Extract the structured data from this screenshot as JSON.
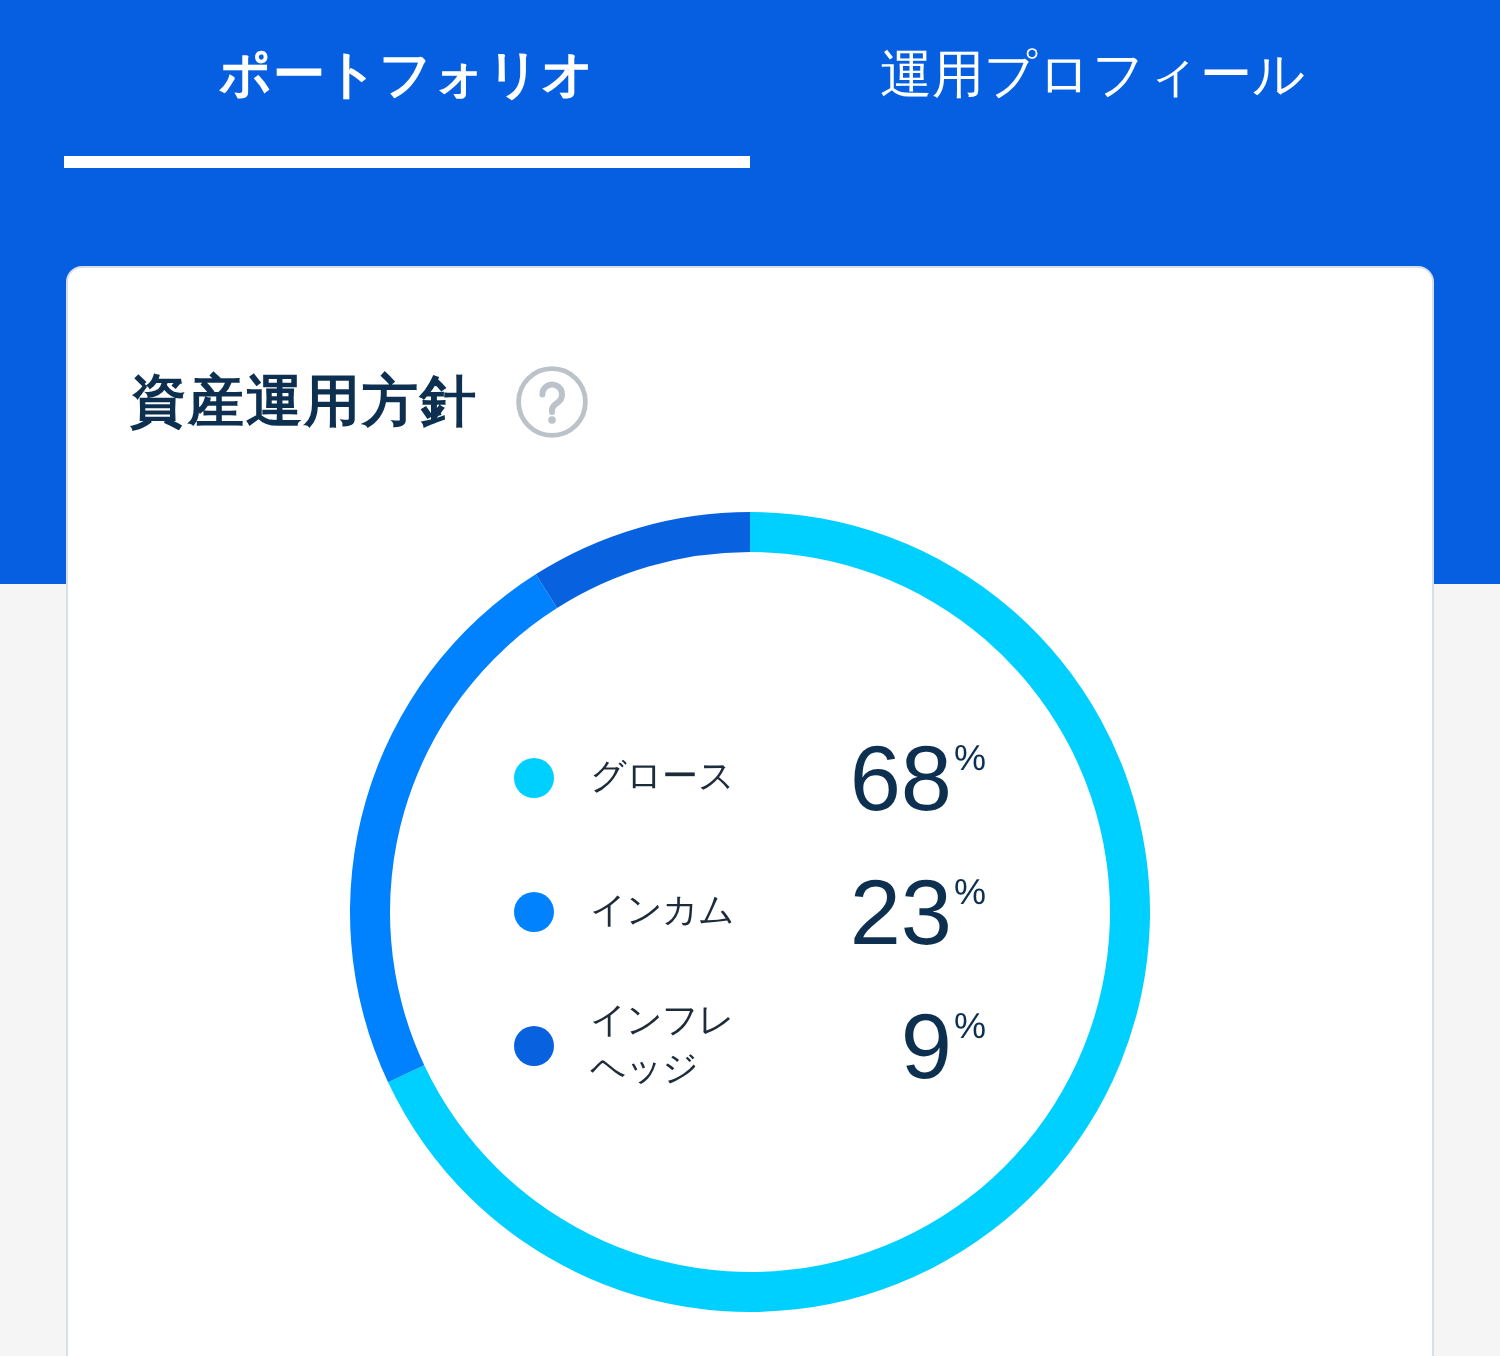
{
  "tabs": [
    {
      "label": "ポートフォリオ",
      "selected": true
    },
    {
      "label": "運用プロフィール",
      "selected": false
    }
  ],
  "policy_card": {
    "title": "資産運用方針",
    "chart_data": {
      "type": "donut",
      "categories": [
        "グロース",
        "インカム",
        "インフレヘッジ"
      ],
      "values": [
        68,
        23,
        9
      ],
      "colors": [
        "#00d0ff",
        "#0082ff",
        "#0862e0"
      ],
      "value_labels": [
        "68$^{%}$",
        "23$^{%}$",
        "9$^{%}$"
      ],
      "legend": true
    }
  }
}
